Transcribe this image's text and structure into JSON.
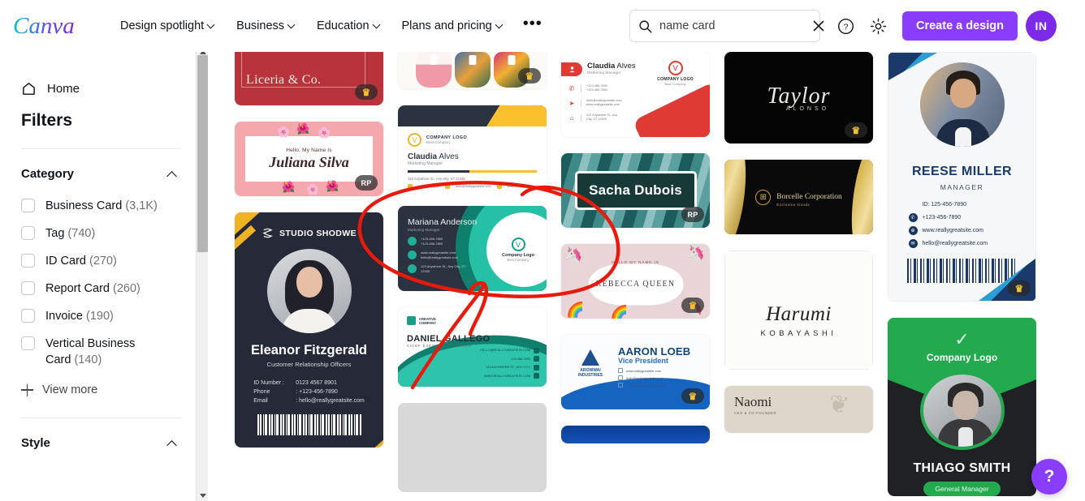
{
  "header": {
    "logo_text": "Canva",
    "nav": [
      {
        "label": "Design spotlight",
        "has_caret": true
      },
      {
        "label": "Business",
        "has_caret": true
      },
      {
        "label": "Education",
        "has_caret": true
      },
      {
        "label": "Plans and pricing",
        "has_caret": true
      }
    ],
    "more_label": "•••",
    "search": {
      "value": "name card",
      "placeholder": "Search",
      "clear_label": "×"
    },
    "help_icon": "question-mark-circle-icon",
    "settings_icon": "gear-icon",
    "create_button": "Create a design",
    "avatar_initials": "IN",
    "accent_color": "#8b3dff",
    "avatar_color": "#7d2ae8"
  },
  "sidebar": {
    "home_label": "Home",
    "title": "Filters",
    "groups": [
      {
        "label": "Category",
        "expanded": true,
        "options": [
          {
            "label": "Business Card",
            "count": "(3,1K)",
            "checked": false
          },
          {
            "label": "Tag",
            "count": "(740)",
            "checked": false
          },
          {
            "label": "ID Card",
            "count": "(270)",
            "checked": false
          },
          {
            "label": "Report Card",
            "count": "(260)",
            "checked": false
          },
          {
            "label": "Invoice",
            "count": "(190)",
            "checked": false
          },
          {
            "label": "Vertical Business Card",
            "count": "(140)",
            "checked": false
          }
        ],
        "view_more": "View more"
      },
      {
        "label": "Style",
        "expanded": true
      }
    ]
  },
  "results": {
    "columns": [
      {
        "cards": [
          {
            "id": "liceria",
            "name": "Liceria & Co.",
            "badge": "crown",
            "badge_text": "♛"
          },
          {
            "id": "juliana",
            "hello": "Hello, My Name Is",
            "name": "Juliana Silva",
            "badge": "rp",
            "badge_text": "RP"
          },
          {
            "id": "eleanor",
            "brand": "STUDIO SHODWE",
            "name": "Eleanor Fitzgerald",
            "role": "Customer Relationship Officers",
            "fields": [
              {
                "label": "ID Number :",
                "value": "0123 4567 8901"
              },
              {
                "label": "Phone",
                "value": ": +123-456-7890"
              },
              {
                "label": "Email",
                "value": ": hello@reallygreatsite.com"
              }
            ]
          }
        ]
      },
      {
        "cards": [
          {
            "id": "pastel",
            "badge": "crown",
            "badge_text": "♛"
          },
          {
            "id": "claudia2",
            "company": "COMPANY LOGO",
            "company_sub": "Best Company",
            "name_bold": "Claudia",
            "name_rest": " Alves",
            "role": "Marketing Manager",
            "address": "123 Anywhere St., Any City, ST 12345",
            "contacts": [
              "+123-456-7890",
              "hello@reallygreatsite.com",
              "www.reallygreatsite.com"
            ]
          },
          {
            "id": "mariana",
            "name": "Mariana Anderson",
            "role": "Marketing Manager",
            "company": "Company Logo",
            "company_sub": "Best Company",
            "contacts": [
              "+123-456-7890\n+123-456-7890",
              "www.reallygreatsite.com\nhello@reallygreatsite.com",
              "123 Anywhere St., Any City, ST\n12345"
            ]
          },
          {
            "id": "daniel",
            "brand": "CREATIVE\nCOMPANY",
            "name": "DANIEL GALLEGO",
            "role": "CHIEF EXECUTIVE OFFICER",
            "contacts": [
              "HELLO@REALLYGREATSITE.COM",
              "123-456-7890",
              "123 ANYWHERE ST., ANY CITY",
              "WWW.REALLYGREATSITE.COM"
            ]
          },
          {
            "id": "placeholder",
            "loading": true
          }
        ]
      },
      {
        "cards": [
          {
            "id": "claudia1",
            "name_bold": "Claudia",
            "name_rest": " Alves",
            "role": "Marketing Manager",
            "company": "COMPANY LOGO",
            "company_sub": "Best Company",
            "rows": [
              "+123-456-7890\n+123-456-7890",
              "hello@reallygreatsite.com\nwww.reallygreatsite.com",
              "123 Anywhere St., Any\nCity, ST 12345"
            ]
          },
          {
            "id": "sacha",
            "name": "Sacha Dubois",
            "badge": "rp",
            "badge_text": "RP"
          },
          {
            "id": "rebecca",
            "hello": "HELLO MY NAME IS",
            "name": "REBECCA QUEEN",
            "badge": "crown",
            "badge_text": "♛"
          },
          {
            "id": "aaron",
            "brand": "AROWWAI\nINDUSTRIES",
            "name": "AARON LOEB",
            "role": "Vice President",
            "contacts": [
              "www.reallygreatsite.com",
              "hello@reallygreatsite.com",
              "123 Anywhere St., Any City"
            ],
            "badge": "crown",
            "badge_text": "♛"
          },
          {
            "id": "blue",
            "loading": false
          }
        ]
      },
      {
        "cards": [
          {
            "id": "taylor",
            "name": "Taylor",
            "sub": "ALONSO",
            "badge": "crown",
            "badge_text": "♛"
          },
          {
            "id": "borcelle",
            "name": "Borcelle Corporation",
            "sub": "Exclusive Goods"
          },
          {
            "id": "harumi",
            "sig": "Harumi",
            "name": "KOBAYASHI"
          },
          {
            "id": "naomi",
            "name": "Naomi",
            "role": "CEO & CO-FOUNDER"
          }
        ]
      },
      {
        "cards": [
          {
            "id": "reese",
            "name": "REESE MILLER",
            "role": "MANAGER",
            "rows": [
              {
                "icon": "id-icon",
                "text": "ID: 125-456-7890"
              },
              {
                "icon": "phone-icon",
                "text": "+123-456-7890"
              },
              {
                "icon": "globe-icon",
                "text": "www.reallygreatsite.com"
              },
              {
                "icon": "mail-icon",
                "text": "hello@reallygreatsite.com"
              }
            ],
            "badge": "crown",
            "badge_text": "♛"
          },
          {
            "id": "thiago",
            "company": "Company Logo",
            "name": "THIAGO SMITH",
            "role": "General Manager"
          }
        ]
      }
    ]
  },
  "fab": {
    "label": "?",
    "color": "#8b3dff"
  },
  "annotation": {
    "type": "hand-drawn-ellipse-with-arrow",
    "color": "#e81a0c"
  }
}
